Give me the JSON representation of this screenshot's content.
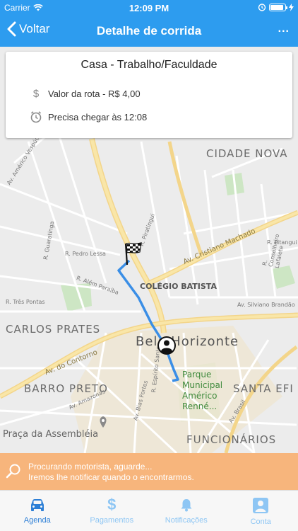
{
  "status_bar": {
    "carrier": "Carrier",
    "time": "12:09 PM"
  },
  "nav": {
    "back_label": "Voltar",
    "title": "Detalhe de corrida",
    "more_label": "..."
  },
  "route_card": {
    "title": "Casa - Trabalho/Faculdade",
    "price_label": "Valor da rota - R$ 4,00",
    "arrival_label": "Precisa chegar às 12:08"
  },
  "map": {
    "districts": [
      "CIDADE NOVA",
      "COLÉGIO BATISTA",
      "CARLOS PRATES",
      "Belo Horizonte",
      "BARRO PRETO",
      "SANTA EFI",
      "FUNCIONÁRIOS"
    ],
    "streets": [
      "Av. Américo Vespúcio",
      "R. Guaratinga",
      "R. Pedro Lessa",
      "R. Piratingui",
      "Av. Cristiano Machado",
      "R. Conselheiro Lafaiete",
      "R. Pitangui",
      "R. Além Paraíba",
      "R. Três Pontas",
      "Av. Silviano Brandão",
      "Av. do Contorno",
      "Av. Amazonas",
      "R. Espírito Santo",
      "Av. Bias Fortes",
      "Av. Brasil"
    ],
    "park_label": [
      "Parque",
      "Municipal",
      "Américo",
      "Renné..."
    ],
    "poi_label": "Praça da Assembléia",
    "route_color": "#3a8ee6"
  },
  "search_banner": {
    "line1": "Procurando motorista, aguarde...",
    "line2": "Iremos lhe notificar quando o encontrarmos.",
    "bg_color": "#f7b57c"
  },
  "tabs": [
    {
      "label": "Agenda",
      "icon": "car-icon",
      "active": true
    },
    {
      "label": "Pagamentos",
      "icon": "dollar-icon",
      "active": false
    },
    {
      "label": "Notificações",
      "icon": "bell-icon",
      "active": false
    },
    {
      "label": "Conta",
      "icon": "user-icon",
      "active": false
    }
  ],
  "colors": {
    "header": "#2d9cef",
    "tab_active": "#2d7fd6",
    "tab_inactive": "#8ec6f4"
  }
}
